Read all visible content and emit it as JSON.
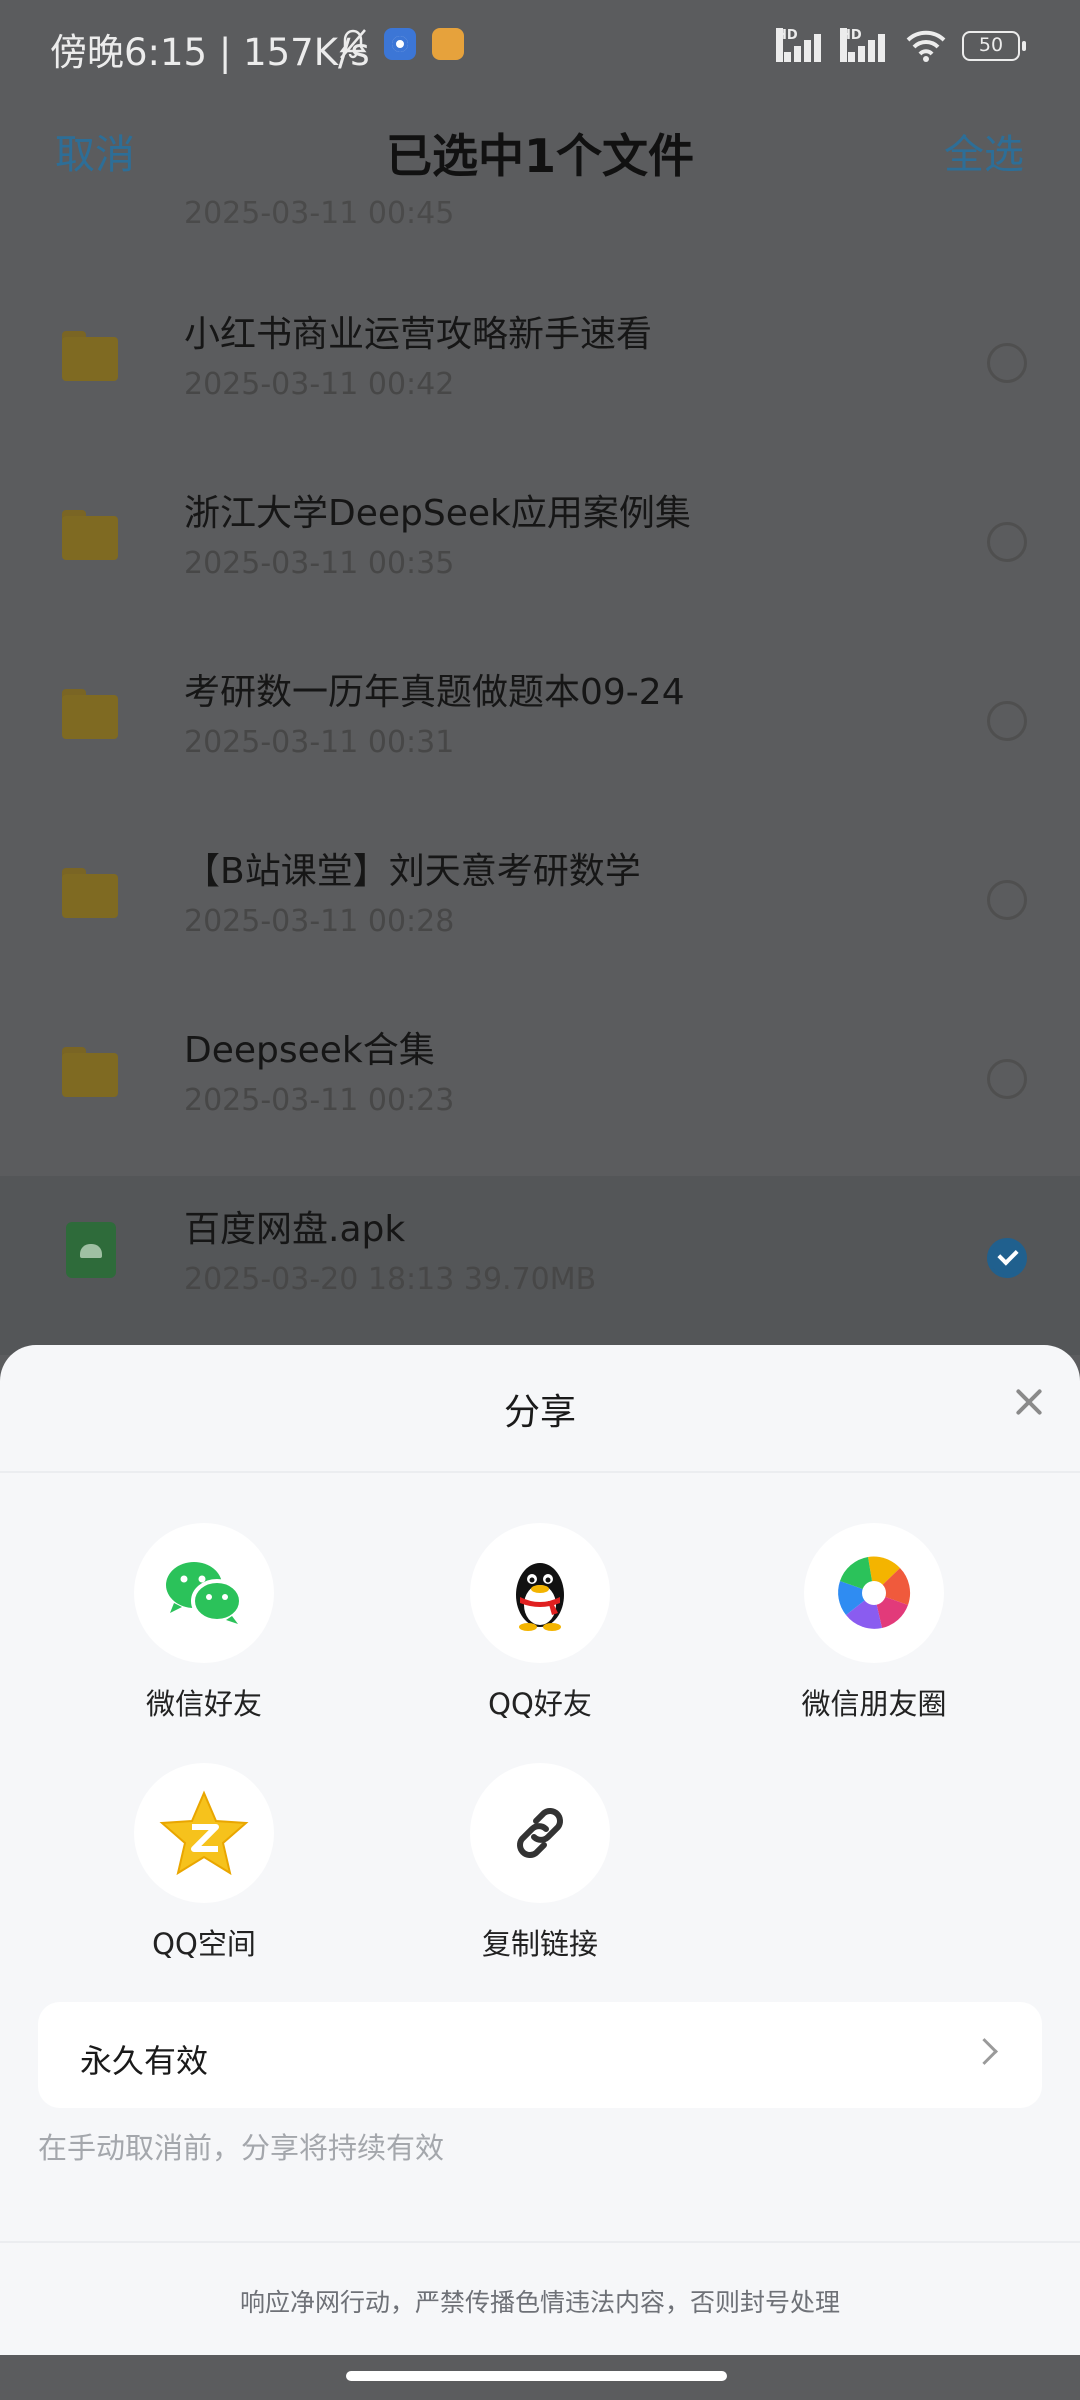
{
  "status_bar": {
    "time": "傍晚6:15 | 157K/s",
    "battery": "50",
    "network_tag": "HD"
  },
  "top_bar": {
    "cancel": "取消",
    "title": "已选中1个文件",
    "select_all": "全选"
  },
  "file_list": {
    "partial_meta": "2025-03-11  00:45",
    "items": [
      {
        "name": "小红书商业运营攻略新手速看",
        "meta": "2025-03-11  00:42",
        "type": "folder",
        "selected": false
      },
      {
        "name": "浙江大学DeepSeek应用案例集",
        "meta": "2025-03-11  00:35",
        "type": "folder",
        "selected": false
      },
      {
        "name": "考研数一历年真题做题本09-24",
        "meta": "2025-03-11  00:31",
        "type": "folder",
        "selected": false
      },
      {
        "name": "【B站课堂】刘天意考研数学",
        "meta": "2025-03-11  00:28",
        "type": "folder",
        "selected": false
      },
      {
        "name": "Deepseek合集",
        "meta": "2025-03-11  00:23",
        "type": "folder",
        "selected": false
      },
      {
        "name": "百度网盘.apk",
        "meta": "2025-03-20  18:13   39.70MB",
        "type": "apk",
        "selected": true
      }
    ]
  },
  "share_sheet": {
    "title": "分享",
    "targets": [
      {
        "label": "微信好友",
        "icon": "wechat-icon"
      },
      {
        "label": "QQ好友",
        "icon": "qq-icon"
      },
      {
        "label": "微信朋友圈",
        "icon": "moments-icon"
      },
      {
        "label": "QQ空间",
        "icon": "qzone-icon"
      },
      {
        "label": "复制链接",
        "icon": "link-icon"
      }
    ],
    "validity_label": "永久有效",
    "validity_hint": "在手动取消前，分享将持续有效",
    "footer": "响应净网行动，严禁传播色情违法内容，否则封号处理"
  },
  "colors": {
    "accent": "#2d6e97",
    "checked": "#20608e",
    "sheet_bg": "#f6f7f9"
  }
}
